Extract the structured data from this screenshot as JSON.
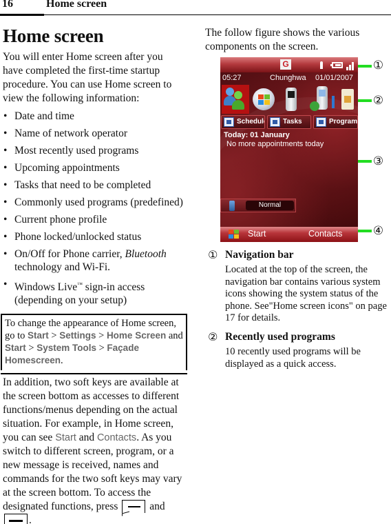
{
  "header": {
    "page_number": "16",
    "section_title": "Home screen"
  },
  "left": {
    "heading": "Home screen",
    "intro": "You will enter Home screen after you have completed the first-time startup procedure. You can use Home screen to view the following information:",
    "bullets": [
      "Date and time",
      "Name of network operator",
      "Most recently used programs",
      "Upcoming appointments",
      "Tasks that need to be completed",
      "Commonly used programs (predefined)",
      "Current phone profile",
      "Phone locked/unlocked status"
    ],
    "bullet_bluetooth": {
      "prefix": "On/Off for Phone carrier, ",
      "italic": "Bluetooth",
      "suffix": " technology and Wi-Fi."
    },
    "bullet_live": {
      "prefix": "Windows Live",
      "tm": "™",
      "suffix": " sign-in access (depending on your setup)"
    },
    "note": {
      "t1": "To change the appearance of Home screen, go to ",
      "start1": "Start",
      "sep1": " > ",
      "settings": "Settings",
      "sep2": " > ",
      "home_screen": "Home Screen",
      "and": " and ",
      "start2": "Start",
      "sep3": " > ",
      "system_tools": "System Tools",
      "sep4": " > ",
      "facade": "Façade Homescreen",
      "end": "."
    },
    "para2": {
      "t1": "In addition, two soft keys are available at the screen bottom as accesses to different functions/menus depending on the actual situation. For example, in Home screen, you can see ",
      "start": "Start",
      "and": " and ",
      "contacts": "Contacts",
      "t2": ". As you switch to different screen, program, or a new message is received, names and commands for the two soft keys may vary at the screen bottom. To access the designated functions, press ",
      "and2": " and ",
      "end": "."
    }
  },
  "right": {
    "intro": "The follow figure shows the various components on the screen.",
    "phone": {
      "nav_icons": [
        "g-icon",
        "speaker-icon",
        "battery-icon",
        "signal-icon"
      ],
      "nav_g": "G",
      "time": "05:27",
      "operator": "Chunghwa",
      "date": "01/01/2007",
      "recent_programs": [
        "contacts-people-icon",
        "windows-start-icon",
        "phone-app-icon",
        "phone-back-icon",
        "sync-sim-icon"
      ],
      "shortcuts": [
        "Schedule",
        "Tasks",
        "Programs"
      ],
      "today_title": "Today: 01 January",
      "today_line": "No more appointments today",
      "profile": "Normal",
      "softkey_left": "Start",
      "softkey_right": "Contacts"
    },
    "callouts": [
      "①",
      "②",
      "③",
      "④"
    ],
    "descriptions": [
      {
        "num": "①",
        "title": "Navigation bar",
        "body": "Located at the top of the screen, the navigation bar contains various system icons showing the system status of the phone. See\"Home screen icons\" on page 17 for details."
      },
      {
        "num": "②",
        "title": "Recently used programs",
        "body": "10 recently used programs will be displayed as a quick access."
      }
    ],
    "colors": {
      "callout_line": "#22dd22",
      "ui_term": "#666666",
      "phone_accent": "#b51111"
    }
  }
}
